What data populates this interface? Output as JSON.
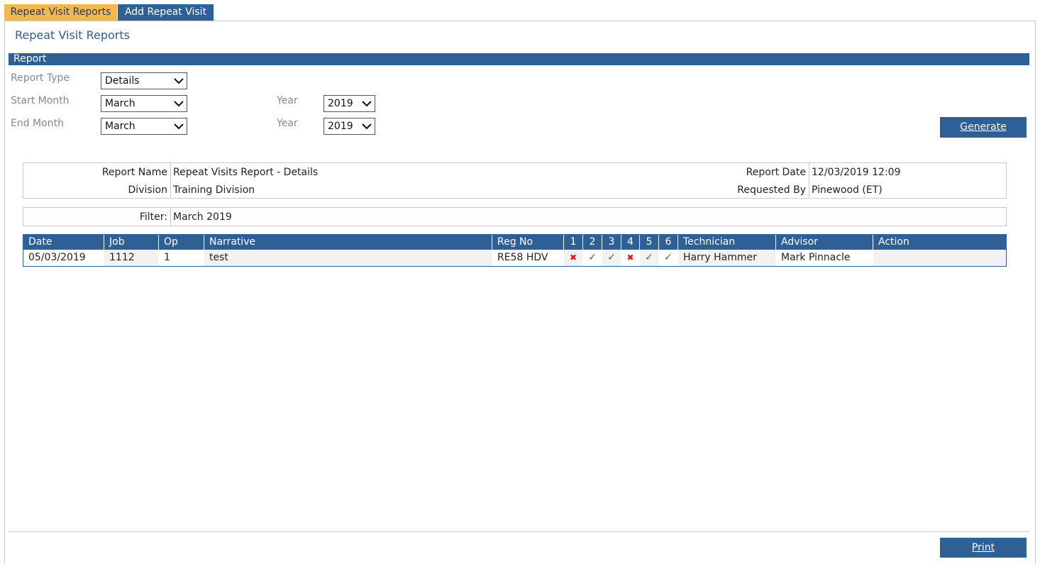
{
  "tabs": [
    {
      "label": "Repeat Visit Reports",
      "active": true
    },
    {
      "label": "Add Repeat Visit",
      "active": false
    }
  ],
  "page_title": "Repeat Visit Reports",
  "section_title": "Report",
  "form": {
    "report_type_label": "Report Type",
    "report_type_value": "Details",
    "start_month_label": "Start Month",
    "start_month_value": "March",
    "start_year_label": "Year",
    "start_year_value": "2019",
    "end_month_label": "End Month",
    "end_month_value": "March",
    "end_year_label": "Year",
    "end_year_value": "2019",
    "generate_label": "Generate"
  },
  "report_info": {
    "name_label": "Report Name",
    "name_value": "Repeat Visits Report - Details",
    "division_label": "Division",
    "division_value": "Training Division",
    "date_label": "Report Date",
    "date_value": "12/03/2019 12:09",
    "requested_label": "Requested By",
    "requested_value": "Pinewood (ET)"
  },
  "filter": {
    "label": "Filter:",
    "value": "March 2019"
  },
  "table": {
    "headers": [
      "Date",
      "Job",
      "Op",
      "Narrative",
      "Reg No",
      "1",
      "2",
      "3",
      "4",
      "5",
      "6",
      "Technician",
      "Advisor",
      "Action"
    ],
    "rows": [
      {
        "date": "05/03/2019",
        "job": "1112",
        "op": "1",
        "narrative": "test",
        "reg_no": "RE58 HDV",
        "checks": [
          "x",
          "ok",
          "ok",
          "x",
          "ok",
          "ok"
        ],
        "technician": "Harry Hammer",
        "advisor": "Mark Pinnacle",
        "action": ""
      }
    ]
  },
  "print_label": "Print",
  "colors": {
    "accent": "#2e5f95",
    "active_tab": "#f2b84f",
    "ok": "#2f7d2f",
    "fail": "#d21f1f"
  }
}
